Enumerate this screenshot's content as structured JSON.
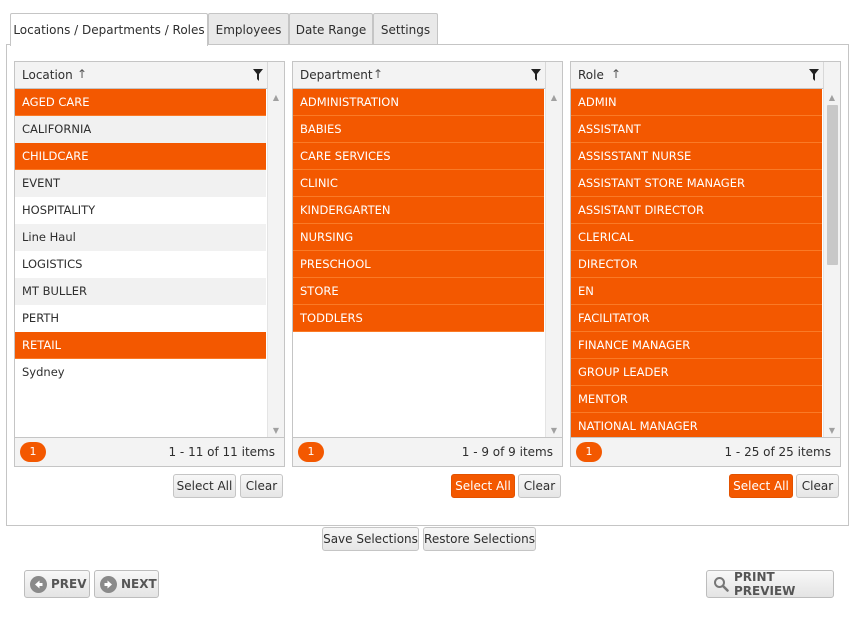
{
  "tabs": [
    {
      "label": "Locations / Departments / Roles"
    },
    {
      "label": "Employees"
    },
    {
      "label": "Date Range"
    },
    {
      "label": "Settings"
    }
  ],
  "grids": {
    "location": {
      "header": "Location",
      "pager_page": "1",
      "pager_info": "1 - 11 of 11 items",
      "rows": [
        {
          "label": "AGED CARE",
          "selected": true
        },
        {
          "label": "CALIFORNIA",
          "selected": false
        },
        {
          "label": "CHILDCARE",
          "selected": true
        },
        {
          "label": "EVENT",
          "selected": false
        },
        {
          "label": "HOSPITALITY",
          "selected": false
        },
        {
          "label": "Line Haul",
          "selected": false
        },
        {
          "label": "LOGISTICS",
          "selected": false
        },
        {
          "label": "MT BULLER",
          "selected": false
        },
        {
          "label": "PERTH",
          "selected": false
        },
        {
          "label": "RETAIL",
          "selected": true
        },
        {
          "label": "Sydney",
          "selected": false
        }
      ]
    },
    "department": {
      "header": "Department",
      "pager_page": "1",
      "pager_info": "1 - 9 of 9 items",
      "rows": [
        {
          "label": "ADMINISTRATION",
          "selected": true
        },
        {
          "label": "BABIES",
          "selected": true
        },
        {
          "label": "CARE SERVICES",
          "selected": true
        },
        {
          "label": "CLINIC",
          "selected": true
        },
        {
          "label": "KINDERGARTEN",
          "selected": true
        },
        {
          "label": "NURSING",
          "selected": true
        },
        {
          "label": "PRESCHOOL",
          "selected": true
        },
        {
          "label": "STORE",
          "selected": true
        },
        {
          "label": "TODDLERS",
          "selected": true
        }
      ]
    },
    "role": {
      "header": "Role",
      "pager_page": "1",
      "pager_info": "1 - 25 of 25 items",
      "rows": [
        {
          "label": "ADMIN",
          "selected": true
        },
        {
          "label": "ASSISTANT",
          "selected": true
        },
        {
          "label": "ASSISSTANT NURSE",
          "selected": true
        },
        {
          "label": "ASSISTANT STORE MANAGER",
          "selected": true
        },
        {
          "label": "ASSISTANT DIRECTOR",
          "selected": true
        },
        {
          "label": "CLERICAL",
          "selected": true
        },
        {
          "label": "DIRECTOR",
          "selected": true
        },
        {
          "label": "EN",
          "selected": true
        },
        {
          "label": "FACILITATOR",
          "selected": true
        },
        {
          "label": "FINANCE MANAGER",
          "selected": true
        },
        {
          "label": "GROUP LEADER",
          "selected": true
        },
        {
          "label": "MENTOR",
          "selected": true
        },
        {
          "label": "NATIONAL MANAGER",
          "selected": true
        }
      ]
    }
  },
  "buttons": {
    "select_all": "Select All",
    "clear": "Clear",
    "save_selections": "Save Selections",
    "restore_selections": "Restore Selections",
    "prev": "PREV",
    "next": "NEXT",
    "print_preview": "PRINT PREVIEW"
  },
  "colors": {
    "accent": "#f35800",
    "selected_row_text": "#ffffff",
    "alt_row": "#f1f1f1",
    "header_bg": "#f3f3f3",
    "border": "#c5c5c5"
  },
  "icons": {
    "sort": "sort-ascending-icon",
    "filter": "filter-icon",
    "prev": "arrow-left-circle-icon",
    "next": "arrow-right-circle-icon",
    "print_preview": "magnifier-icon"
  }
}
